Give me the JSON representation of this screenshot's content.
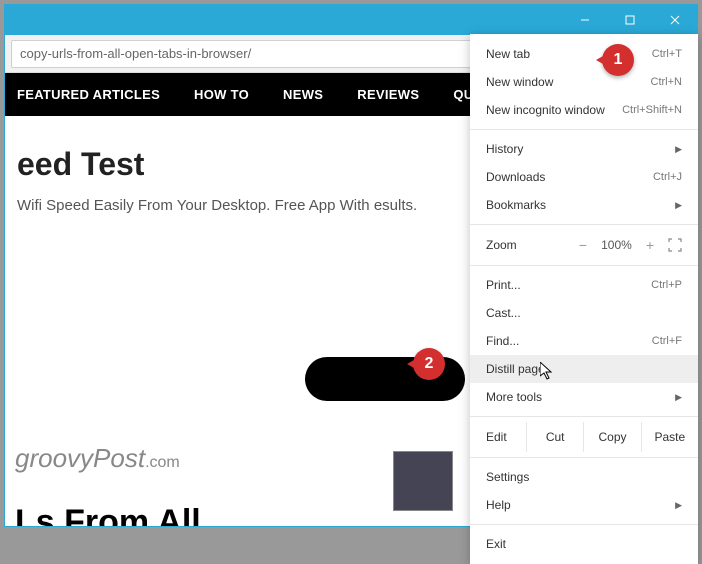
{
  "titlebar": {
    "minimize": "—",
    "maximize": "☐",
    "close": "✕"
  },
  "address": {
    "url": "copy-urls-from-all-open-tabs-in-browser/"
  },
  "nav": [
    "FEATURED ARTICLES",
    "HOW TO",
    "NEWS",
    "REVIEWS",
    "QUIC"
  ],
  "page": {
    "heading": "eed Test",
    "subtitle": "Wifi Speed Easily From Your Desktop. Free App With esults.",
    "brand_g": "g",
    "brand_rest": "roovyPost",
    "brand_suffix": ".com",
    "heading2": "Ls From All"
  },
  "menu": {
    "new_tab": {
      "label": "New tab",
      "shortcut": "Ctrl+T"
    },
    "new_window": {
      "label": "New window",
      "shortcut": "Ctrl+N"
    },
    "new_incognito": {
      "label": "New incognito window",
      "shortcut": "Ctrl+Shift+N"
    },
    "history": {
      "label": "History"
    },
    "downloads": {
      "label": "Downloads",
      "shortcut": "Ctrl+J"
    },
    "bookmarks": {
      "label": "Bookmarks"
    },
    "zoom_label": "Zoom",
    "zoom_value": "100%",
    "print": {
      "label": "Print...",
      "shortcut": "Ctrl+P"
    },
    "cast": {
      "label": "Cast..."
    },
    "find": {
      "label": "Find...",
      "shortcut": "Ctrl+F"
    },
    "distill": {
      "label": "Distill page"
    },
    "more_tools": {
      "label": "More tools"
    },
    "edit": "Edit",
    "cut": "Cut",
    "copy": "Copy",
    "paste": "Paste",
    "settings": {
      "label": "Settings"
    },
    "help": {
      "label": "Help"
    },
    "exit": {
      "label": "Exit"
    }
  },
  "callouts": {
    "one": "1",
    "two": "2"
  }
}
